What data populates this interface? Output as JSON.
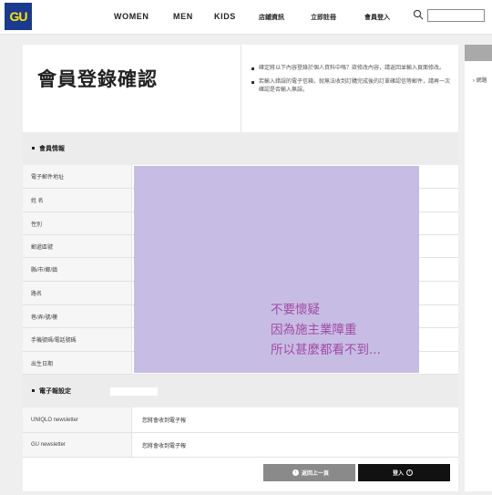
{
  "header": {
    "logo": "GU",
    "nav": [
      "WOMEN",
      "MEN",
      "KIDS",
      "店鋪資訊",
      "立即註冊",
      "會員登入"
    ],
    "search_placeholder": ""
  },
  "page": {
    "title": "會員登錄確認",
    "notes": [
      "確定將以下內容登錄於個人資料中嗎？欲修改內容，請返回並輸入頁面修改。",
      "若輸入錯誤的電子信箱，就無法收到訂購完成後的訂單確認信等郵件，請再一次確認是否輸入無誤。"
    ]
  },
  "member_info": {
    "heading": "會員情報",
    "fields": [
      {
        "label": "電子郵件地址",
        "value": ""
      },
      {
        "label": "姓 名",
        "value": ""
      },
      {
        "label": "性別",
        "value": ""
      },
      {
        "label": "郵遞區號",
        "value": ""
      },
      {
        "label": "縣/市/鄉/鎮",
        "value": ""
      },
      {
        "label": "路名",
        "value": ""
      },
      {
        "label": "巷/弄/號/樓",
        "value": ""
      },
      {
        "label": "手機號碼/電話號碼",
        "value": ""
      },
      {
        "label": "出生日期",
        "value": ""
      }
    ]
  },
  "overlay": {
    "lines": [
      "不要懷疑",
      "因為施主業障重",
      "所以甚麼都看不到..."
    ],
    "color": "#c7bde4",
    "text_color": "#a24aa6"
  },
  "email_settings": {
    "heading": "電子報設定",
    "fields": [
      {
        "label": "UNIQLO newsletter",
        "value": "您將會收到電子報"
      },
      {
        "label": "GU newsletter",
        "value": "您將會收到電子報"
      }
    ]
  },
  "buttons": {
    "back": "返回上一頁",
    "login": "登入"
  },
  "side": {
    "item": "› 網路"
  }
}
